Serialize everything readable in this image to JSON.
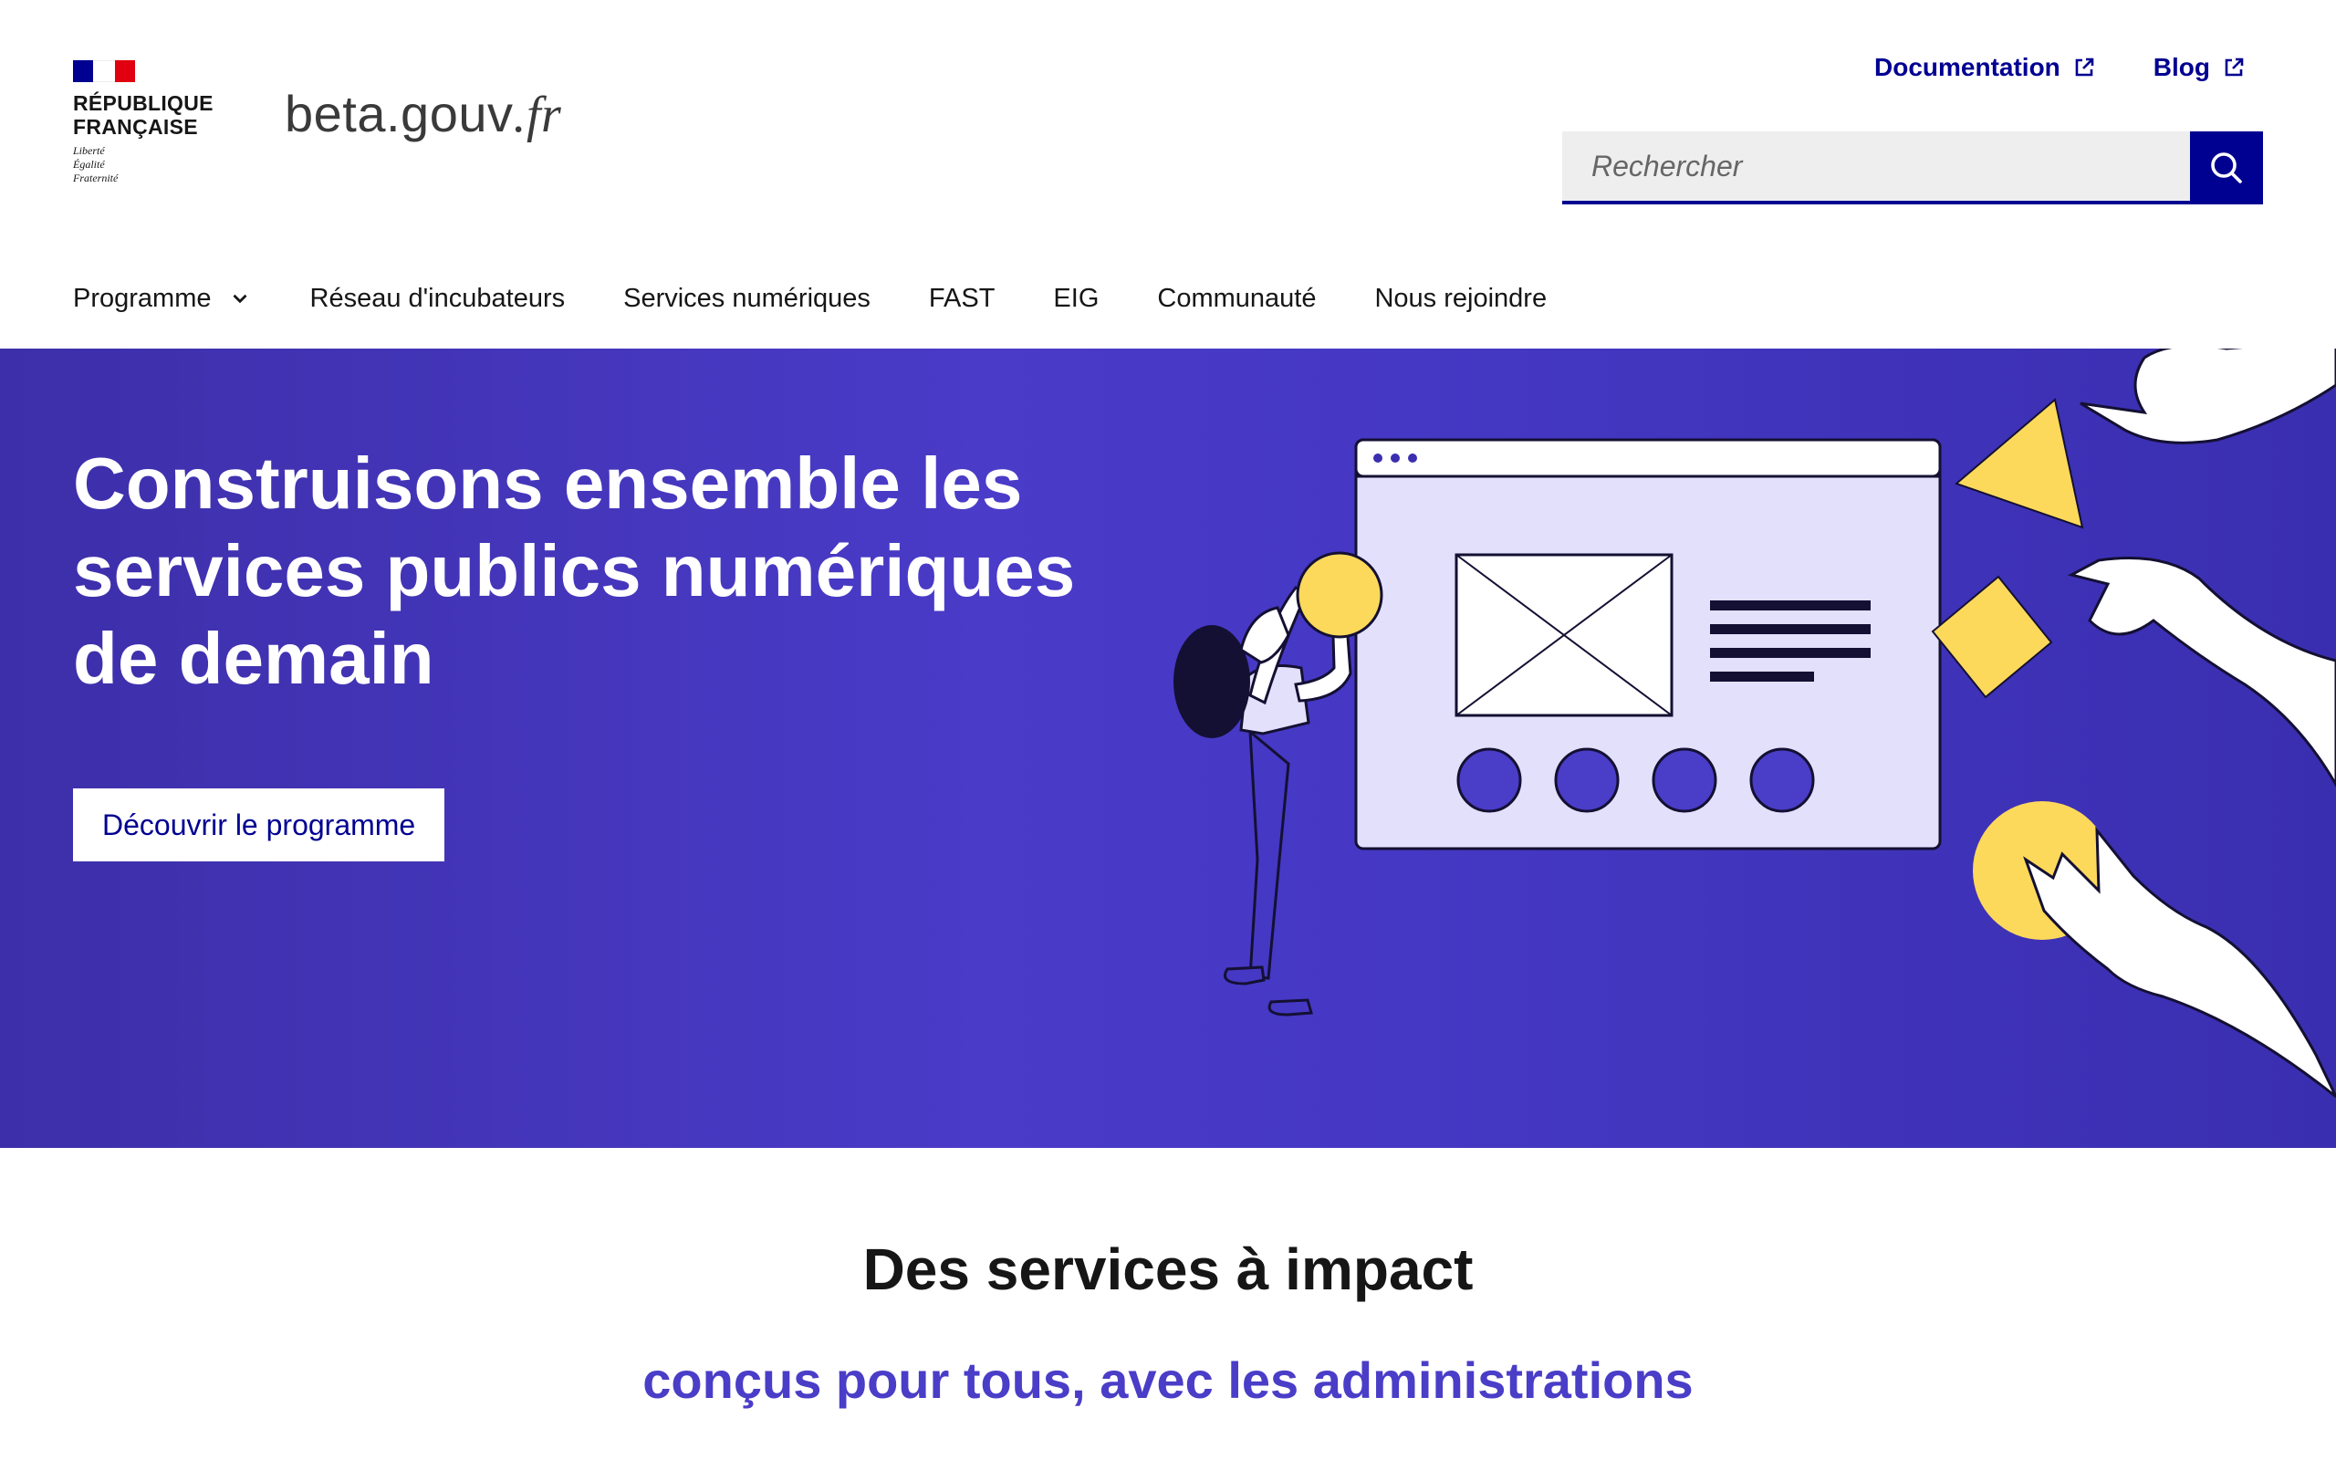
{
  "header": {
    "republique_line1": "République",
    "republique_line2": "Française",
    "motto": [
      "Liberté",
      "Égalité",
      "Fraternité"
    ],
    "site_name_main": "beta.gouv",
    "site_name_suffix": ".fr",
    "quick_links": [
      {
        "label": "Documentation",
        "icon": "external-link-icon"
      },
      {
        "label": "Blog",
        "icon": "external-link-icon"
      }
    ],
    "search": {
      "placeholder": "Rechercher",
      "value": "",
      "button_icon": "search-icon"
    }
  },
  "nav": {
    "items": [
      {
        "label": "Programme",
        "has_dropdown": true
      },
      {
        "label": "Réseau d'incubateurs"
      },
      {
        "label": "Services numériques"
      },
      {
        "label": "FAST"
      },
      {
        "label": "EIG"
      },
      {
        "label": "Communauté"
      },
      {
        "label": "Nous rejoindre"
      }
    ]
  },
  "hero": {
    "title": "Construisons ensemble les services publics numériques de demain",
    "cta_label": "Découvrir le programme"
  },
  "impact": {
    "title": "Des services à impact",
    "subtitle": "conçus pour tous, avec les administrations"
  },
  "colors": {
    "brand_blue": "#000091",
    "hero_background": "#4a3bc8",
    "accent_yellow": "#fdd95b",
    "window_fill": "#e3e0fb",
    "subtitle_purple": "#4a3dc7"
  }
}
